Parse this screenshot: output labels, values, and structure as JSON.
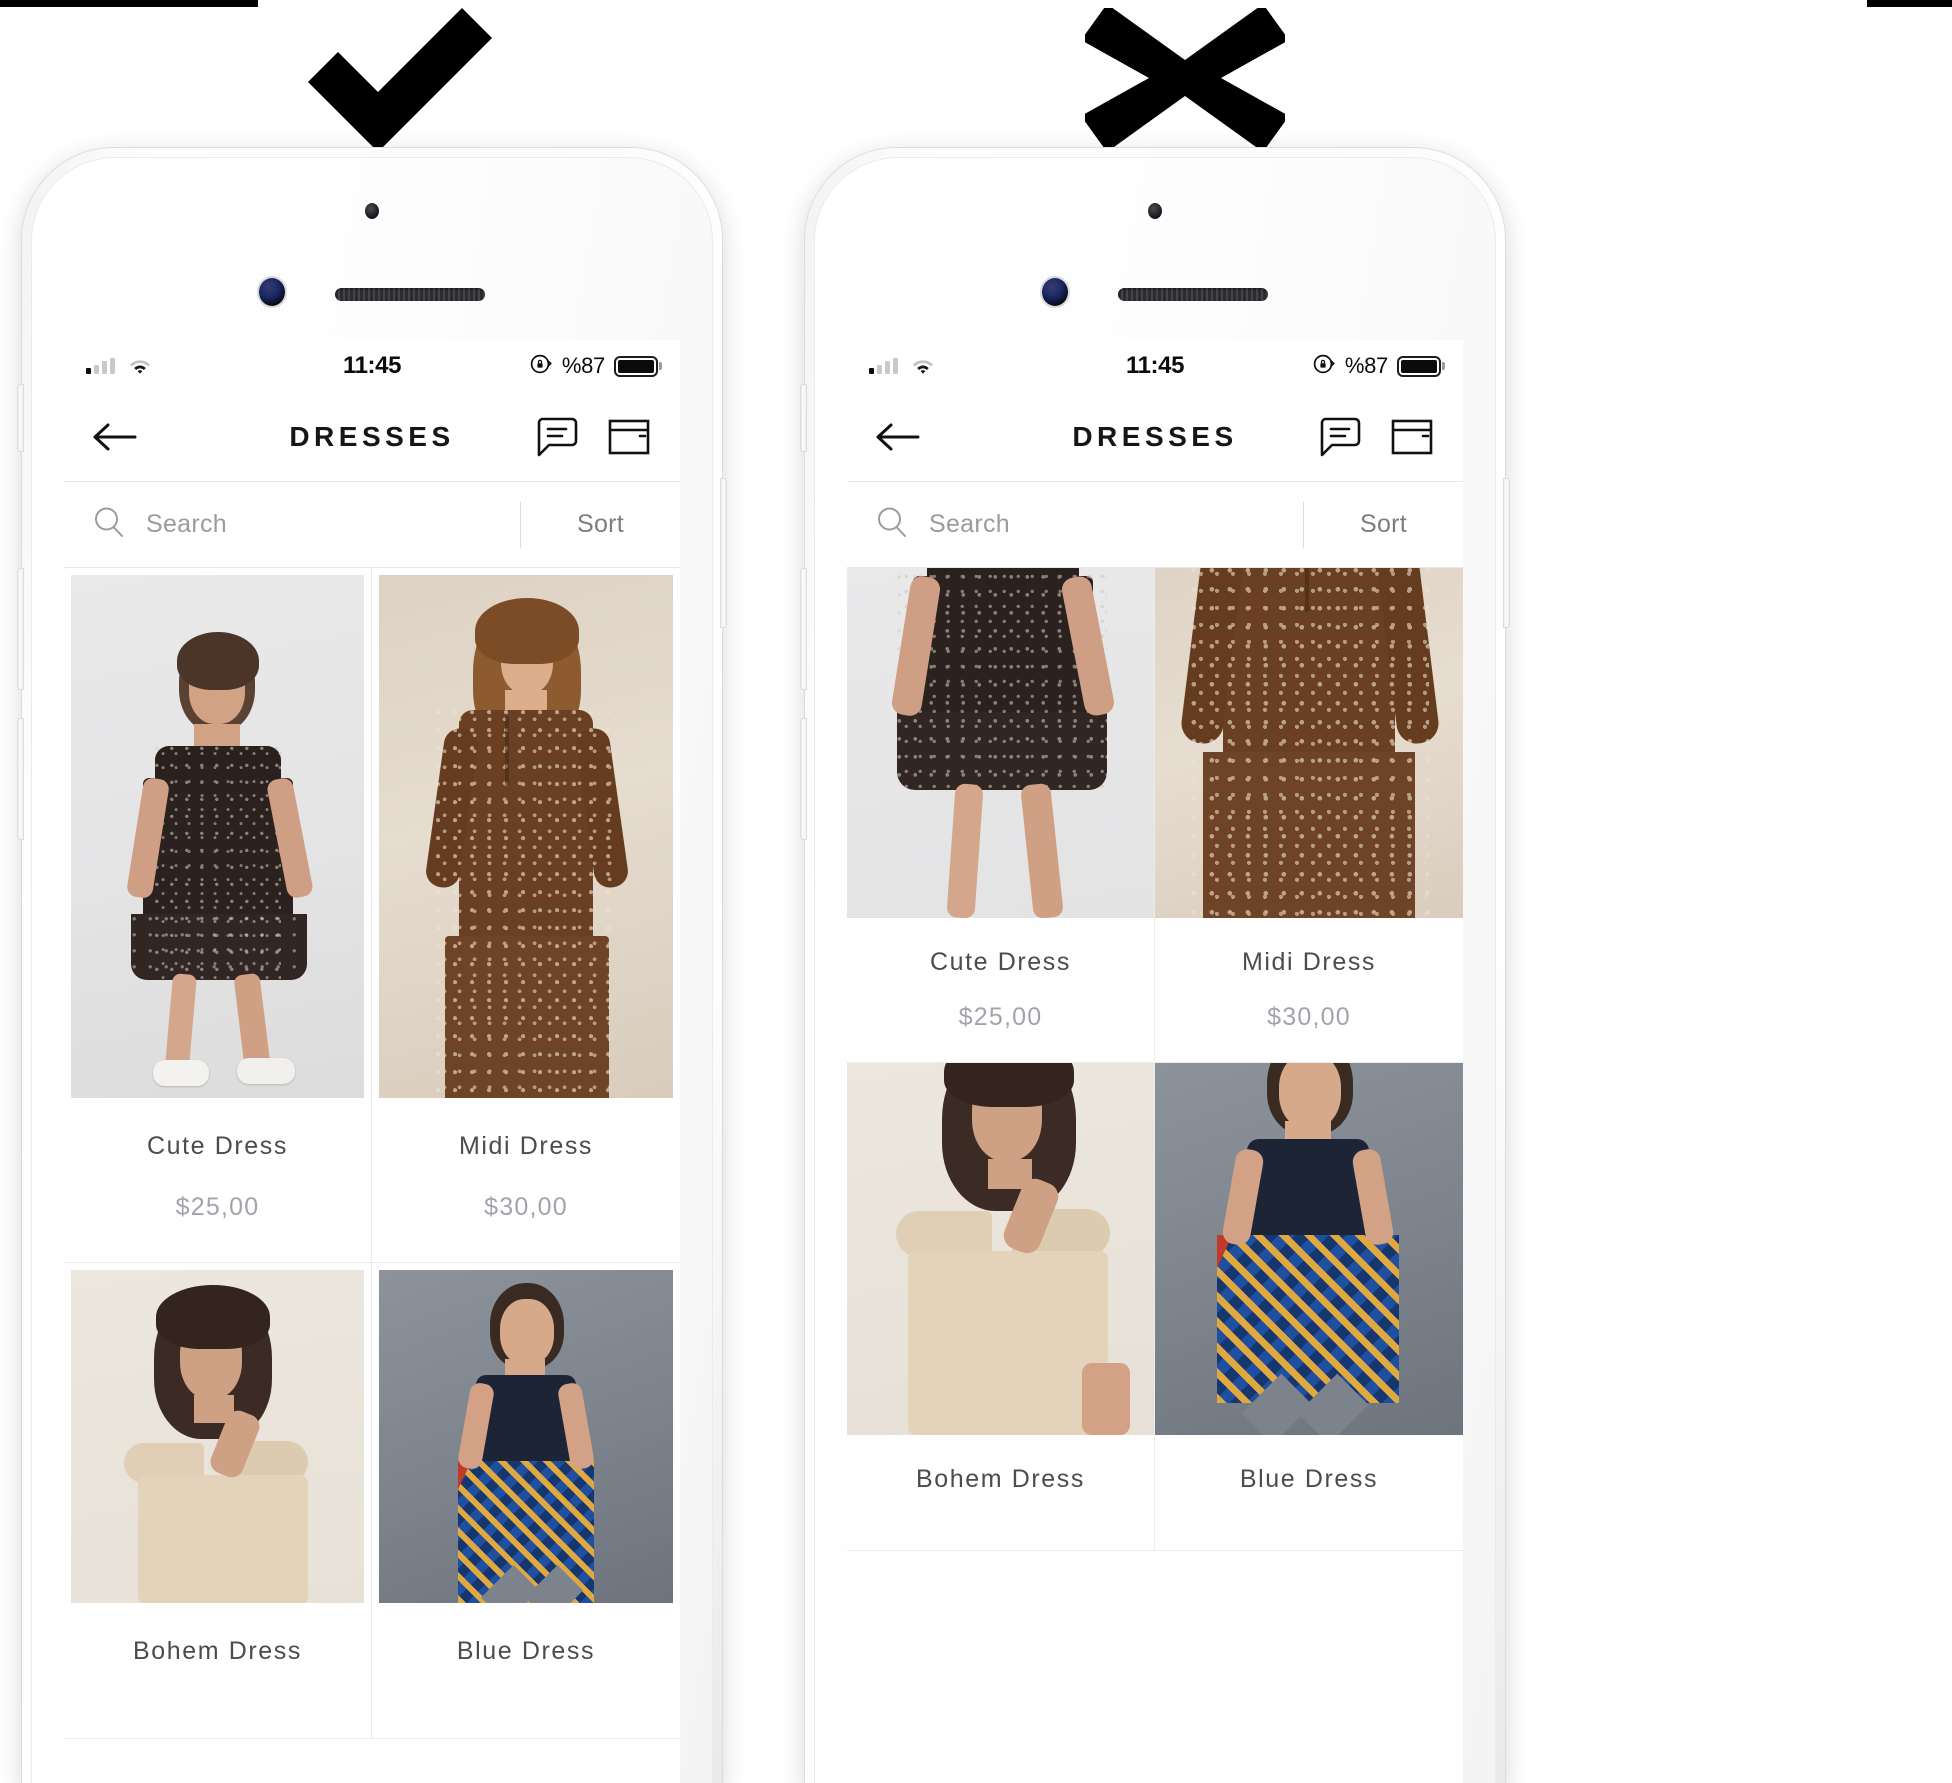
{
  "verdict": {
    "good_icon": "check-icon",
    "bad_icon": "cross-icon"
  },
  "phones": [
    {
      "id": "good",
      "verdict": "check",
      "status_bar": {
        "signal_icon": "cellular-signal-icon",
        "wifi_icon": "wifi-icon",
        "time": "11:45",
        "rotation_lock_icon": "rotation-lock-icon",
        "battery_percent": "%87",
        "battery_icon": "battery-full-icon"
      },
      "nav": {
        "back_icon": "back-arrow-icon",
        "title": "DRESSES",
        "chat_icon": "chat-bubble-icon",
        "bag_icon": "shopping-bag-icon"
      },
      "search": {
        "icon": "search-icon",
        "placeholder": "Search",
        "value": "",
        "sort_label": "Sort"
      },
      "products": [
        {
          "name": "Cute Dress",
          "price": "$25,00",
          "image": "model-black-floral-minidress-on-light-grey"
        },
        {
          "name": "Midi Dress",
          "price": "$30,00",
          "image": "model-brown-floral-midi-dress-on-beige"
        },
        {
          "name": "Bohem Dress",
          "price": "",
          "image": "model-beige-ruffle-dress-seated"
        },
        {
          "name": "Blue Dress",
          "price": "",
          "image": "model-navy-top-printed-skirt-on-grey"
        }
      ]
    },
    {
      "id": "bad",
      "verdict": "cross",
      "status_bar": {
        "signal_icon": "cellular-signal-icon",
        "wifi_icon": "wifi-icon",
        "time": "11:45",
        "rotation_lock_icon": "rotation-lock-icon",
        "battery_percent": "%87",
        "battery_icon": "battery-full-icon"
      },
      "nav": {
        "back_icon": "back-arrow-icon",
        "title": "DRESSES",
        "chat_icon": "chat-bubble-icon",
        "bag_icon": "shopping-bag-icon"
      },
      "search": {
        "icon": "search-icon",
        "placeholder": "Search",
        "value": "",
        "sort_label": "Sort"
      },
      "products": [
        {
          "name": "Cute Dress",
          "price": "$25,00",
          "image": "model-black-floral-minidress-cropped"
        },
        {
          "name": "Midi Dress",
          "price": "$30,00",
          "image": "model-brown-floral-midi-dress-cropped"
        },
        {
          "name": "Bohem Dress",
          "price": "",
          "image": "model-beige-ruffle-dress-cropped"
        },
        {
          "name": "Blue Dress",
          "price": "",
          "image": "model-navy-top-printed-skirt-cropped"
        }
      ]
    }
  ],
  "colors": {
    "text_primary": "#161616",
    "text_secondary": "#4b4b50",
    "text_muted": "#a3a3ab",
    "placeholder": "#9b9b9f",
    "divider": "#e8e8e8",
    "screen_bg": "#ffffff",
    "mark": "#000000"
  }
}
